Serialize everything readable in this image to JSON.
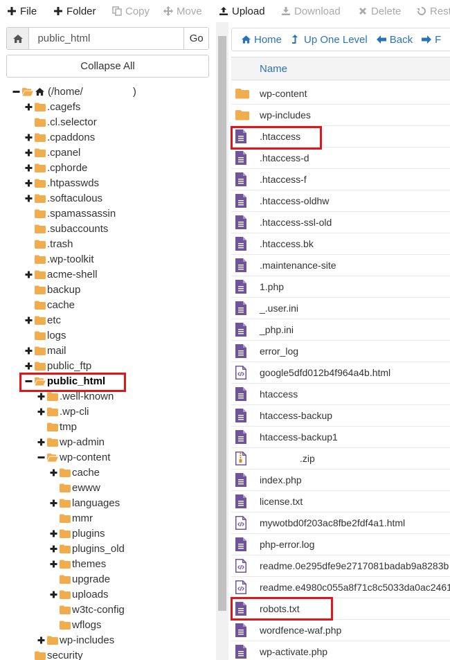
{
  "toolbar": {
    "items": [
      {
        "label": "File",
        "icon": "plus-icon",
        "enabled": true
      },
      {
        "label": "Folder",
        "icon": "plus-icon",
        "enabled": true
      },
      {
        "label": "Copy",
        "icon": "copy-icon",
        "enabled": false
      },
      {
        "label": "Move",
        "icon": "move-icon",
        "enabled": false
      },
      {
        "label": "Upload",
        "icon": "upload-icon",
        "enabled": true
      },
      {
        "label": "Download",
        "icon": "download-icon",
        "enabled": false
      },
      {
        "label": "Delete",
        "icon": "delete-icon",
        "enabled": false
      },
      {
        "label": "Rest",
        "icon": "restore-icon",
        "enabled": false
      }
    ]
  },
  "path_bar": {
    "value": "public_html",
    "go_label": "Go"
  },
  "collapse_label": "Collapse All",
  "tree": [
    {
      "label": "(/home/",
      "suffix": ")",
      "toggle": "minus",
      "level": 0,
      "open": true,
      "home": true
    },
    {
      "label": ".cagefs",
      "toggle": "plus",
      "level": 1
    },
    {
      "label": ".cl.selector",
      "toggle": "none",
      "level": 1
    },
    {
      "label": ".cpaddons",
      "toggle": "plus",
      "level": 1
    },
    {
      "label": ".cpanel",
      "toggle": "plus",
      "level": 1
    },
    {
      "label": ".cphorde",
      "toggle": "plus",
      "level": 1
    },
    {
      "label": ".htpasswds",
      "toggle": "plus",
      "level": 1
    },
    {
      "label": ".softaculous",
      "toggle": "plus",
      "level": 1
    },
    {
      "label": ".spamassassin",
      "toggle": "none",
      "level": 1
    },
    {
      "label": ".subaccounts",
      "toggle": "none",
      "level": 1
    },
    {
      "label": ".trash",
      "toggle": "none",
      "level": 1
    },
    {
      "label": ".wp-toolkit",
      "toggle": "none",
      "level": 1
    },
    {
      "label": "acme-shell",
      "toggle": "plus",
      "level": 1
    },
    {
      "label": "backup",
      "toggle": "none",
      "level": 1
    },
    {
      "label": "cache",
      "toggle": "none",
      "level": 1
    },
    {
      "label": "etc",
      "toggle": "plus",
      "level": 1
    },
    {
      "label": "logs",
      "toggle": "none",
      "level": 1
    },
    {
      "label": "mail",
      "toggle": "plus",
      "level": 1
    },
    {
      "label": "public_ftp",
      "toggle": "plus",
      "level": 1
    },
    {
      "label": "public_html",
      "toggle": "minus",
      "level": 1,
      "open": true,
      "selected": true
    },
    {
      "label": ".well-known",
      "toggle": "plus",
      "level": 2
    },
    {
      "label": ".wp-cli",
      "toggle": "plus",
      "level": 2
    },
    {
      "label": "tmp",
      "toggle": "none",
      "level": 2
    },
    {
      "label": "wp-admin",
      "toggle": "plus",
      "level": 2
    },
    {
      "label": "wp-content",
      "toggle": "minus",
      "level": 2,
      "open": true
    },
    {
      "label": "cache",
      "toggle": "plus",
      "level": 3
    },
    {
      "label": "ewww",
      "toggle": "none",
      "level": 3
    },
    {
      "label": "languages",
      "toggle": "plus",
      "level": 3
    },
    {
      "label": "mmr",
      "toggle": "none",
      "level": 3
    },
    {
      "label": "plugins",
      "toggle": "plus",
      "level": 3
    },
    {
      "label": "plugins_old",
      "toggle": "plus",
      "level": 3
    },
    {
      "label": "themes",
      "toggle": "plus",
      "level": 3
    },
    {
      "label": "upgrade",
      "toggle": "none",
      "level": 3
    },
    {
      "label": "uploads",
      "toggle": "plus",
      "level": 3
    },
    {
      "label": "w3tc-config",
      "toggle": "none",
      "level": 3
    },
    {
      "label": "wflogs",
      "toggle": "none",
      "level": 3
    },
    {
      "label": "wp-includes",
      "toggle": "plus",
      "level": 2
    },
    {
      "label": "security",
      "toggle": "none",
      "level": 1
    }
  ],
  "nav": [
    {
      "label": "Home",
      "icon": "home-icon"
    },
    {
      "label": "Up One Level",
      "icon": "level-up-icon"
    },
    {
      "label": "Back",
      "icon": "back-arrow-icon"
    },
    {
      "label": "F",
      "icon": "forward-arrow-icon"
    }
  ],
  "table": {
    "header": "Name",
    "rows": [
      {
        "name": "wp-content",
        "type": "folder"
      },
      {
        "name": "wp-includes",
        "type": "folder"
      },
      {
        "name": ".htaccess",
        "type": "text",
        "highlight": true
      },
      {
        "name": ".htaccess-d",
        "type": "text"
      },
      {
        "name": ".htaccess-f",
        "type": "text"
      },
      {
        "name": ".htaccess-oldhw",
        "type": "text"
      },
      {
        "name": ".htaccess-ssl-old",
        "type": "text"
      },
      {
        "name": ".htaccess.bk",
        "type": "text"
      },
      {
        "name": ".maintenance-site",
        "type": "text"
      },
      {
        "name": "1.php",
        "type": "text"
      },
      {
        "name": "_.user.ini",
        "type": "text"
      },
      {
        "name": "_php.ini",
        "type": "text"
      },
      {
        "name": "error_log",
        "type": "text"
      },
      {
        "name": "google5dfd012b4f964a4b.html",
        "type": "html"
      },
      {
        "name": "htaccess",
        "type": "text"
      },
      {
        "name": "htaccess-backup",
        "type": "text"
      },
      {
        "name": "htaccess-backup1",
        "type": "text"
      },
      {
        "name": ".zip",
        "type": "zip",
        "redacted": true
      },
      {
        "name": "index.php",
        "type": "text"
      },
      {
        "name": "license.txt",
        "type": "text"
      },
      {
        "name": "mywotbd0f203ac8fbe2fdf4a1.html",
        "type": "html"
      },
      {
        "name": "php-error.log",
        "type": "text"
      },
      {
        "name": "readme.0e295dfe9e2717081badab9a8283b",
        "type": "html"
      },
      {
        "name": "readme.e4980c055a8f71c8c5033da0ac2461",
        "type": "html"
      },
      {
        "name": "robots.txt",
        "type": "text",
        "highlight": true
      },
      {
        "name": "wordfence-waf.php",
        "type": "text"
      },
      {
        "name": "wp-activate.php",
        "type": "text"
      }
    ]
  },
  "colors": {
    "link": "#2a73b8",
    "folder": "#f0ad4e",
    "file": "#6f5499",
    "highlight": "#e2151b"
  }
}
